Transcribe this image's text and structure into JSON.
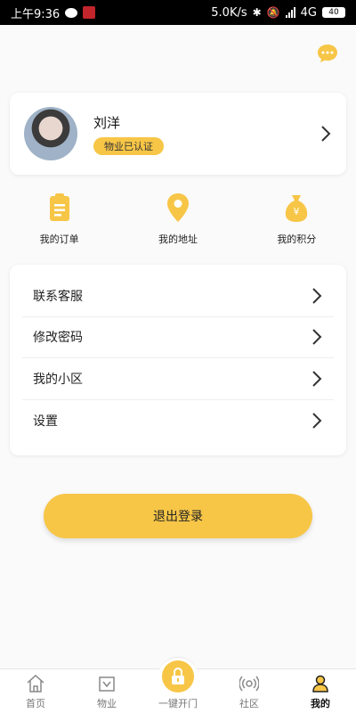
{
  "status_bar": {
    "time": "上午9:36",
    "net_speed": "5.0K/s",
    "network": "4G",
    "battery": "40"
  },
  "header": {
    "chat_icon": "chat-bubble-icon"
  },
  "profile": {
    "name": "刘洋",
    "badge": "物业已认证"
  },
  "quick_actions": [
    {
      "label": "我的订单",
      "icon": "clipboard-icon"
    },
    {
      "label": "我的地址",
      "icon": "location-pin-icon"
    },
    {
      "label": "我的积分",
      "icon": "money-bag-icon"
    }
  ],
  "menu": [
    {
      "label": "联系客服"
    },
    {
      "label": "修改密码"
    },
    {
      "label": "我的小区"
    },
    {
      "label": "设置"
    }
  ],
  "logout_label": "退出登录",
  "tabs": [
    {
      "label": "首页",
      "icon": "home-icon"
    },
    {
      "label": "物业",
      "icon": "property-icon"
    },
    {
      "label": "一键开门",
      "icon": "lock-icon"
    },
    {
      "label": "社区",
      "icon": "broadcast-icon"
    },
    {
      "label": "我的",
      "icon": "user-icon",
      "active": true
    }
  ],
  "colors": {
    "accent": "#f7c647",
    "background": "#fafafa"
  }
}
